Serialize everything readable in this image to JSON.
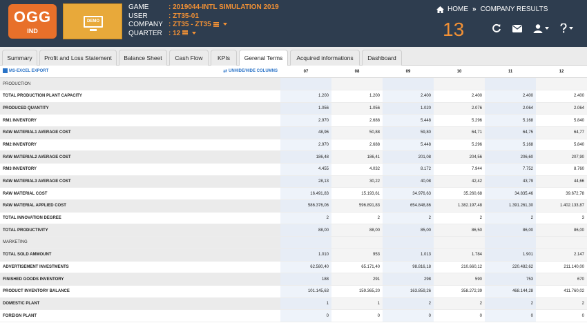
{
  "logo": {
    "title": "OGG",
    "subtitle": "IND"
  },
  "demo": {
    "label": "DEMO"
  },
  "info": {
    "game_label": "GAME",
    "game_value": "2019044-INTL SIMULATION 2019",
    "user_label": "USER",
    "user_value": "ZT35-01",
    "company_label": "COMPANY",
    "company_value": "ZT35 - ZT35",
    "quarter_label": "QUARTER",
    "quarter_value": "12"
  },
  "nav": {
    "home": "HOME",
    "separator": "»",
    "current": "COMPANY RESULTS"
  },
  "counter": "13",
  "tabs": [
    "Summary",
    "Profit and Loss Statement",
    "Balance Sheet",
    "Cash Flow",
    "KPIs",
    "Gerenal Terms",
    "Acquired informations",
    "Dashboard"
  ],
  "active_tab": "Gerenal Terms",
  "toolbar": {
    "export": "MS-EXCEL EXPORT",
    "toggle": "UNHIDE/HIDE COLUMNS"
  },
  "columns": [
    "07",
    "08",
    "09",
    "10",
    "11",
    "12"
  ],
  "rows": [
    {
      "label": "PRODUCTION",
      "section": true,
      "values": [
        "",
        "",
        "",
        "",
        "",
        ""
      ]
    },
    {
      "label": "TOTAL PRODUCTION PLANT CAPACITY",
      "values": [
        "1.200",
        "1.200",
        "2.400",
        "2.400",
        "2.400",
        "2.400"
      ]
    },
    {
      "label": "PRODUCED QUANTITY",
      "values": [
        "1.056",
        "1.056",
        "1.020",
        "2.076",
        "2.064",
        "2.064"
      ]
    },
    {
      "label": "RM1 INVENTORY",
      "values": [
        "2.970",
        "2.688",
        "5.448",
        "5.296",
        "5.168",
        "5.840"
      ]
    },
    {
      "label": "RAW MATERIAL1 AVERAGE COST",
      "values": [
        "48,96",
        "50,88",
        "59,80",
        "64,71",
        "64,75",
        "64,77"
      ]
    },
    {
      "label": "RM2 INVENTORY",
      "values": [
        "2.970",
        "2.688",
        "5.448",
        "5.296",
        "5.168",
        "5.840"
      ]
    },
    {
      "label": "RAW MATERIAL2 AVERAGE COST",
      "values": [
        "186,48",
        "186,41",
        "201,08",
        "204,56",
        "206,60",
        "207,90"
      ]
    },
    {
      "label": "RM3 INVENTORY",
      "values": [
        "4.455",
        "4.032",
        "8.172",
        "7.944",
        "7.752",
        "8.760"
      ]
    },
    {
      "label": "RAW MATERIAL3 AVERAGE COST",
      "values": [
        "28,13",
        "30,22",
        "40,08",
        "42,42",
        "43,79",
        "44,66"
      ]
    },
    {
      "label": "RAW MATERIAL COST",
      "values": [
        "16.491,83",
        "15.193,61",
        "34.976,63",
        "35.260,68",
        "34.835,46",
        "39.672,78"
      ]
    },
    {
      "label": "RAW MATERIAL APPLIED COST",
      "values": [
        "586.376,06",
        "596.891,83",
        "654.848,86",
        "1.382.197,48",
        "1.391.261,30",
        "1.402.133,87"
      ]
    },
    {
      "label": "TOTAL INNOVATION DEGREE",
      "values": [
        "2",
        "2",
        "2",
        "2",
        "2",
        "3"
      ]
    },
    {
      "label": "TOTAL PRODUCTIVITY",
      "values": [
        "88,00",
        "88,00",
        "85,00",
        "86,50",
        "86,00",
        "86,00"
      ]
    },
    {
      "label": "MARKETING",
      "section": true,
      "values": [
        "",
        "",
        "",
        "",
        "",
        ""
      ]
    },
    {
      "label": "TOTAL SOLD AMMOUNT",
      "values": [
        "1.010",
        "953",
        "1.013",
        "1.784",
        "1.901",
        "2.147"
      ]
    },
    {
      "label": "ADVERTISEMENT INVESTMENTS",
      "values": [
        "62.580,40",
        "65.171,40",
        "98.816,18",
        "210.660,12",
        "220.482,62",
        "211.140,00"
      ]
    },
    {
      "label": "FINISHED GOODS INVENTORY",
      "values": [
        "188",
        "291",
        "298",
        "590",
        "753",
        "670"
      ]
    },
    {
      "label": "PRODUCT INVENTORY BALANCE",
      "values": [
        "101.145,63",
        "159.365,20",
        "163.859,26",
        "358.272,39",
        "468.144,28",
        "411.760,02"
      ]
    },
    {
      "label": "DOMESTIC PLANT",
      "values": [
        "1",
        "1",
        "2",
        "2",
        "2",
        "2"
      ]
    },
    {
      "label": "FOREIGN PLANT",
      "values": [
        "0",
        "0",
        "0",
        "0",
        "0",
        "0"
      ]
    }
  ]
}
